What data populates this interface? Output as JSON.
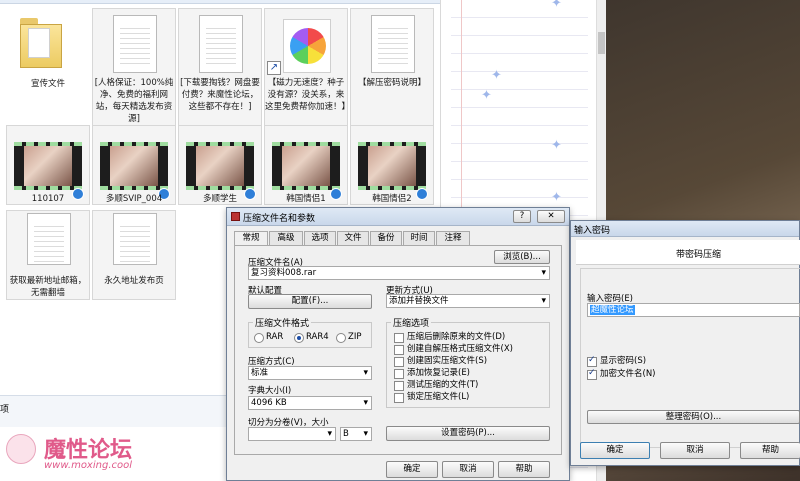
{
  "explorer": {
    "tiles": [
      {
        "label": "宣传文件",
        "kind": "folder"
      },
      {
        "label": "[人格保证：100%纯净、免费的福利网站，每天精选发布资源]",
        "kind": "doc"
      },
      {
        "label": "[下载要掏钱？网盘要付费？来魔性论坛，这些都不存在！]",
        "kind": "doc"
      },
      {
        "label": "【磁力无速度？种子没有源？没关系，来这里免费帮你加速！】",
        "kind": "app"
      },
      {
        "label": "【解压密码说明】",
        "kind": "doc"
      },
      {
        "label": "110107",
        "kind": "video"
      },
      {
        "label": "多顺SVIP_004",
        "kind": "video"
      },
      {
        "label": "多顺学生",
        "kind": "video"
      },
      {
        "label": "韩国情侣1",
        "kind": "video"
      },
      {
        "label": "韩国情侣2",
        "kind": "video"
      },
      {
        "label": "获取最新地址邮箱，无需翻墙",
        "kind": "doc"
      },
      {
        "label": "永久地址发布页",
        "kind": "doc"
      }
    ],
    "side_text": "项"
  },
  "watermark": {
    "name": "魔性论坛",
    "url": "www.moxing.cool"
  },
  "archive_dialog": {
    "title": "压缩文件名和参数",
    "help": "?",
    "close": "✕",
    "tabs": [
      "常规",
      "高级",
      "选项",
      "文件",
      "备份",
      "时间",
      "注释"
    ],
    "archive_name_label": "压缩文件名(A)",
    "browse": "浏览(B)...",
    "archive_name": "复习资料008.rar",
    "default_config_label": "默认配置",
    "config_button": "配置(F)...",
    "update_mode_label": "更新方式(U)",
    "update_mode": "添加并替换文件",
    "format_group": "压缩文件格式",
    "formats": [
      "RAR",
      "RAR4",
      "ZIP"
    ],
    "format_selected": "RAR4",
    "method_label": "压缩方式(C)",
    "method": "标准",
    "dict_label": "字典大小(I)",
    "dict": "4096 KB",
    "split_label": "切分为分卷(V)，大小",
    "split_value": "",
    "split_unit": "B",
    "options_group": "压缩选项",
    "options": [
      {
        "label": "压缩后删除原来的文件(D)",
        "checked": false
      },
      {
        "label": "创建自解压格式压缩文件(X)",
        "checked": false
      },
      {
        "label": "创建固实压缩文件(S)",
        "checked": false
      },
      {
        "label": "添加恢复记录(E)",
        "checked": false
      },
      {
        "label": "测试压缩的文件(T)",
        "checked": false
      },
      {
        "label": "锁定压缩文件(L)",
        "checked": false
      }
    ],
    "set_password": "设置密码(P)...",
    "ok": "确定",
    "cancel": "取消",
    "help_btn": "帮助"
  },
  "password_dialog": {
    "title": "输入密码",
    "header": "带密码压缩",
    "password_label": "输入密码(E)",
    "password_value": "超魔性论坛",
    "show_password": "显示密码(S)",
    "encrypt_names": "加密文件名(N)",
    "organize": "整理密码(O)...",
    "ok": "确定",
    "cancel": "取消",
    "help": "帮助"
  },
  "colors": {
    "accent": "#2f7fd8",
    "selection": "#3399ff",
    "watermark": "#e05a8a"
  }
}
